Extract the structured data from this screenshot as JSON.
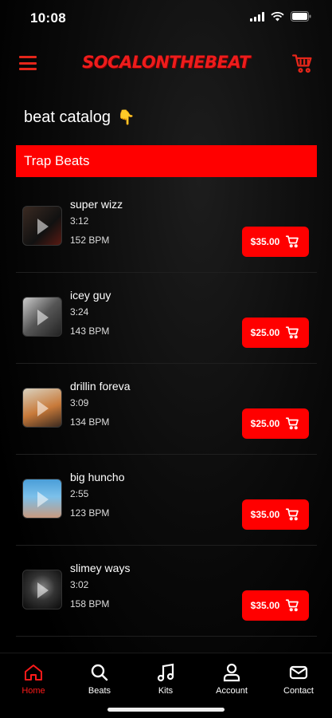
{
  "status_bar": {
    "time": "10:08"
  },
  "header": {
    "brand": "SOCALONTHEBEAT"
  },
  "catalog": {
    "title": "beat catalog",
    "emoji": "👇",
    "category": "Trap Beats"
  },
  "beats": [
    {
      "name": "super wizz",
      "duration": "3:12",
      "bpm": "152 BPM",
      "price": "$35.00"
    },
    {
      "name": "icey guy",
      "duration": "3:24",
      "bpm": "143 BPM",
      "price": "$25.00"
    },
    {
      "name": "drillin foreva",
      "duration": "3:09",
      "bpm": "134 BPM",
      "price": "$25.00"
    },
    {
      "name": "big huncho",
      "duration": "2:55",
      "bpm": "123 BPM",
      "price": "$35.00"
    },
    {
      "name": "slimey ways",
      "duration": "3:02",
      "bpm": "158 BPM",
      "price": "$35.00"
    }
  ],
  "tabs": [
    {
      "label": "Home",
      "icon": "home-icon",
      "active": true
    },
    {
      "label": "Beats",
      "icon": "search-icon",
      "active": false
    },
    {
      "label": "Kits",
      "icon": "music-note-icon",
      "active": false
    },
    {
      "label": "Account",
      "icon": "user-icon",
      "active": false
    },
    {
      "label": "Contact",
      "icon": "mail-icon",
      "active": false
    }
  ],
  "colors": {
    "accent": "#ff0000",
    "brand": "#ee1c1c",
    "background": "#000000"
  }
}
